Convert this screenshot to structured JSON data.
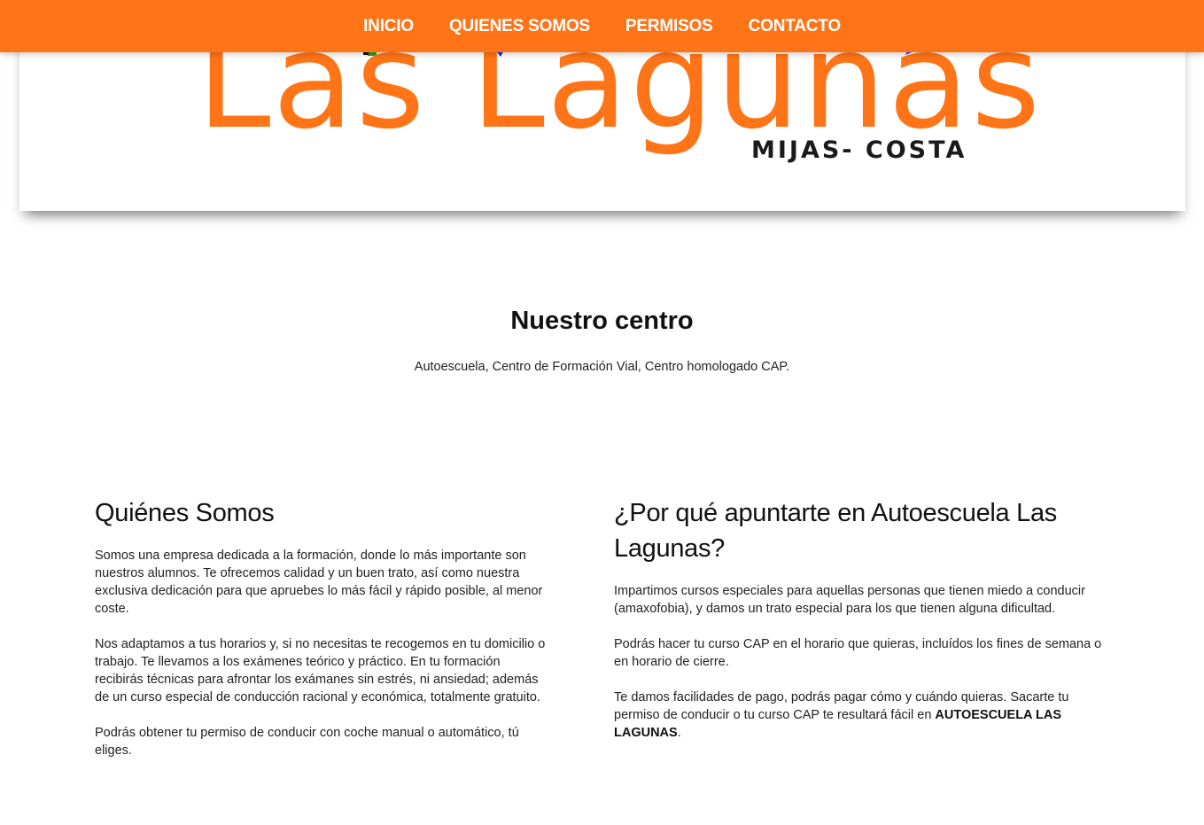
{
  "nav": {
    "items": [
      "INICIO",
      "QUIENES SOMOS",
      "PERMISOS",
      "CONTACTO"
    ]
  },
  "logo": {
    "title": "Las Lagunas",
    "subtitle": "MIJAS- COSTA"
  },
  "centro": {
    "title": "Nuestro centro",
    "subtitle": "Autoescuela, Centro de Formación Vial, Centro homologado CAP."
  },
  "quienes": {
    "title": "Quiénes Somos",
    "p1": "Somos una empresa dedicada a la formación, donde lo más importante son nuestros alumnos. Te ofrecemos calidad y un buen trato, así como nuestra exclusiva dedicación para que apruebes lo más fácil y rápido posible, al menor coste.",
    "p2": "Nos adaptamos a tus horarios y, si no necesitas te recogemos en tu domicilio o trabajo. Te llevamos a los exámenes teórico y práctico. En tu formación recibirás técnicas para afrontar los exámanes sin estrés, ni ansiedad; además de un curso especial de conducción racional y económica, totalmente gratuito.",
    "p3": "Podrás obtener tu permiso de conducir con coche manual o automático, tú eliges."
  },
  "porque": {
    "title": "¿Por qué apuntarte en Autoescuela Las Lagunas?",
    "p1": "Impartimos cursos especiales para aquellas personas que tienen miedo a conducir (amaxofobia), y damos un trato especial para los que tienen alguna dificultad.",
    "p2": "Podrás hacer tu curso CAP en el horario que quieras, incluídos los fines de semana o en horario de cierre.",
    "p3_text": "Te damos facilidades de pago, podrás pagar cómo y cuándo quieras. Sacarte tu permiso de conducir o tu curso CAP te resultará fácil en ",
    "p3_bold": "AUTOESCUELA LAS LAGUNAS",
    "p3_end": "."
  },
  "colors": {
    "accent": "#ff7417",
    "text": "#111111",
    "logo_blue": "#1a2fd6",
    "logo_green": "#1fa51f"
  }
}
